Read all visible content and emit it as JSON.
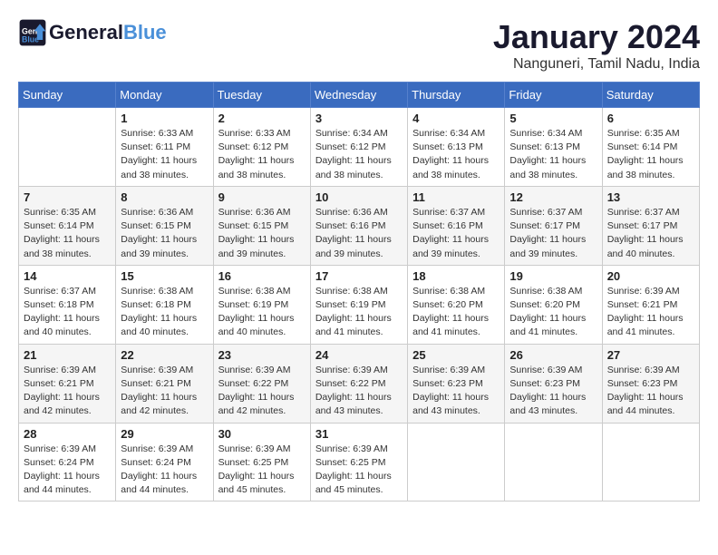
{
  "header": {
    "logo_line1": "General",
    "logo_line2": "Blue",
    "month": "January 2024",
    "location": "Nanguneri, Tamil Nadu, India"
  },
  "weekdays": [
    "Sunday",
    "Monday",
    "Tuesday",
    "Wednesday",
    "Thursday",
    "Friday",
    "Saturday"
  ],
  "weeks": [
    [
      {
        "day": "",
        "info": ""
      },
      {
        "day": "1",
        "info": "Sunrise: 6:33 AM\nSunset: 6:11 PM\nDaylight: 11 hours\nand 38 minutes."
      },
      {
        "day": "2",
        "info": "Sunrise: 6:33 AM\nSunset: 6:12 PM\nDaylight: 11 hours\nand 38 minutes."
      },
      {
        "day": "3",
        "info": "Sunrise: 6:34 AM\nSunset: 6:12 PM\nDaylight: 11 hours\nand 38 minutes."
      },
      {
        "day": "4",
        "info": "Sunrise: 6:34 AM\nSunset: 6:13 PM\nDaylight: 11 hours\nand 38 minutes."
      },
      {
        "day": "5",
        "info": "Sunrise: 6:34 AM\nSunset: 6:13 PM\nDaylight: 11 hours\nand 38 minutes."
      },
      {
        "day": "6",
        "info": "Sunrise: 6:35 AM\nSunset: 6:14 PM\nDaylight: 11 hours\nand 38 minutes."
      }
    ],
    [
      {
        "day": "7",
        "info": "Sunrise: 6:35 AM\nSunset: 6:14 PM\nDaylight: 11 hours\nand 38 minutes."
      },
      {
        "day": "8",
        "info": "Sunrise: 6:36 AM\nSunset: 6:15 PM\nDaylight: 11 hours\nand 39 minutes."
      },
      {
        "day": "9",
        "info": "Sunrise: 6:36 AM\nSunset: 6:15 PM\nDaylight: 11 hours\nand 39 minutes."
      },
      {
        "day": "10",
        "info": "Sunrise: 6:36 AM\nSunset: 6:16 PM\nDaylight: 11 hours\nand 39 minutes."
      },
      {
        "day": "11",
        "info": "Sunrise: 6:37 AM\nSunset: 6:16 PM\nDaylight: 11 hours\nand 39 minutes."
      },
      {
        "day": "12",
        "info": "Sunrise: 6:37 AM\nSunset: 6:17 PM\nDaylight: 11 hours\nand 39 minutes."
      },
      {
        "day": "13",
        "info": "Sunrise: 6:37 AM\nSunset: 6:17 PM\nDaylight: 11 hours\nand 40 minutes."
      }
    ],
    [
      {
        "day": "14",
        "info": "Sunrise: 6:37 AM\nSunset: 6:18 PM\nDaylight: 11 hours\nand 40 minutes."
      },
      {
        "day": "15",
        "info": "Sunrise: 6:38 AM\nSunset: 6:18 PM\nDaylight: 11 hours\nand 40 minutes."
      },
      {
        "day": "16",
        "info": "Sunrise: 6:38 AM\nSunset: 6:19 PM\nDaylight: 11 hours\nand 40 minutes."
      },
      {
        "day": "17",
        "info": "Sunrise: 6:38 AM\nSunset: 6:19 PM\nDaylight: 11 hours\nand 41 minutes."
      },
      {
        "day": "18",
        "info": "Sunrise: 6:38 AM\nSunset: 6:20 PM\nDaylight: 11 hours\nand 41 minutes."
      },
      {
        "day": "19",
        "info": "Sunrise: 6:38 AM\nSunset: 6:20 PM\nDaylight: 11 hours\nand 41 minutes."
      },
      {
        "day": "20",
        "info": "Sunrise: 6:39 AM\nSunset: 6:21 PM\nDaylight: 11 hours\nand 41 minutes."
      }
    ],
    [
      {
        "day": "21",
        "info": "Sunrise: 6:39 AM\nSunset: 6:21 PM\nDaylight: 11 hours\nand 42 minutes."
      },
      {
        "day": "22",
        "info": "Sunrise: 6:39 AM\nSunset: 6:21 PM\nDaylight: 11 hours\nand 42 minutes."
      },
      {
        "day": "23",
        "info": "Sunrise: 6:39 AM\nSunset: 6:22 PM\nDaylight: 11 hours\nand 42 minutes."
      },
      {
        "day": "24",
        "info": "Sunrise: 6:39 AM\nSunset: 6:22 PM\nDaylight: 11 hours\nand 43 minutes."
      },
      {
        "day": "25",
        "info": "Sunrise: 6:39 AM\nSunset: 6:23 PM\nDaylight: 11 hours\nand 43 minutes."
      },
      {
        "day": "26",
        "info": "Sunrise: 6:39 AM\nSunset: 6:23 PM\nDaylight: 11 hours\nand 43 minutes."
      },
      {
        "day": "27",
        "info": "Sunrise: 6:39 AM\nSunset: 6:23 PM\nDaylight: 11 hours\nand 44 minutes."
      }
    ],
    [
      {
        "day": "28",
        "info": "Sunrise: 6:39 AM\nSunset: 6:24 PM\nDaylight: 11 hours\nand 44 minutes."
      },
      {
        "day": "29",
        "info": "Sunrise: 6:39 AM\nSunset: 6:24 PM\nDaylight: 11 hours\nand 44 minutes."
      },
      {
        "day": "30",
        "info": "Sunrise: 6:39 AM\nSunset: 6:25 PM\nDaylight: 11 hours\nand 45 minutes."
      },
      {
        "day": "31",
        "info": "Sunrise: 6:39 AM\nSunset: 6:25 PM\nDaylight: 11 hours\nand 45 minutes."
      },
      {
        "day": "",
        "info": ""
      },
      {
        "day": "",
        "info": ""
      },
      {
        "day": "",
        "info": ""
      }
    ]
  ]
}
